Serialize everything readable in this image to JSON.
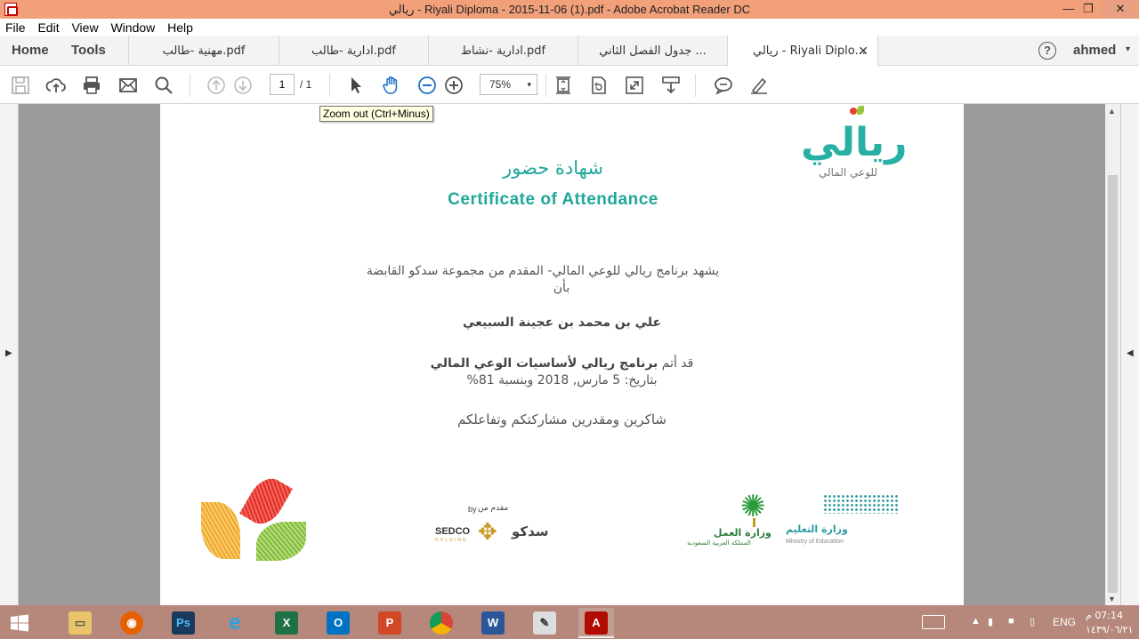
{
  "window": {
    "title": "ريالي - Riyali Diploma - 2015-11-06 (1).pdf - Adobe Acrobat Reader DC",
    "minimize": "—",
    "restore": "❐",
    "close": "✕"
  },
  "menu": [
    "File",
    "Edit",
    "View",
    "Window",
    "Help"
  ],
  "nav": {
    "home": "Home",
    "tools": "Tools"
  },
  "tabs": [
    {
      "label": "مهنية -طالب.pdf"
    },
    {
      "label": "ادارية -طالب.pdf"
    },
    {
      "label": "ادارية -نشاط.pdf"
    },
    {
      "label": "جدول الفصل الثاني ..."
    },
    {
      "label": "ريالي - Riyali Diplo...",
      "close": "✕"
    }
  ],
  "user": {
    "help": "?",
    "name": "ahmed",
    "caret": "▾"
  },
  "toolbar": {
    "page_current": "1",
    "page_total": "/ 1",
    "zoom": "75%",
    "zoom_caret": "▾",
    "tooltip": "Zoom out (Ctrl+Minus)"
  },
  "document": {
    "title_ar": "شهادة حضور",
    "title_en": "Certificate of Attendance",
    "line1": "يشهد برنامج ريالي للوعي المالي- المقدم من مجموعة سدكو القابضة",
    "line2": "بأن",
    "name": "علي بن محمد بن عجينة السبيعي",
    "completed_prefix": "قد أتم",
    "completed_program": "برنامج ريالي لأساسيات الوعي المالي",
    "date_line": "بتاريخ: 5 مارس, 2018 وبنسبة 81%",
    "thanks": "شاكرين ومقدرين مشاركتكم وتفاعلكم",
    "logo_main": "ريالي",
    "logo_sub": "للوعي المالي",
    "sponsor_label_ar": "مقدم من",
    "sponsor_label_en": "by",
    "sponsor_name": "SEDCO",
    "sponsor_sub": "HOLDING",
    "sponsor_ar": "سدكو",
    "ministry_labor": "وزارة العمل",
    "ministry_labor_sub": "المملكة العربية السعودية",
    "ministry_edu": "وزارة التعليم",
    "ministry_edu_en": "Ministry of Education"
  },
  "taskbar": {
    "lang": "ENG",
    "time": "07:14 م",
    "date": "١٤٣٩/٠٦/٢١"
  }
}
